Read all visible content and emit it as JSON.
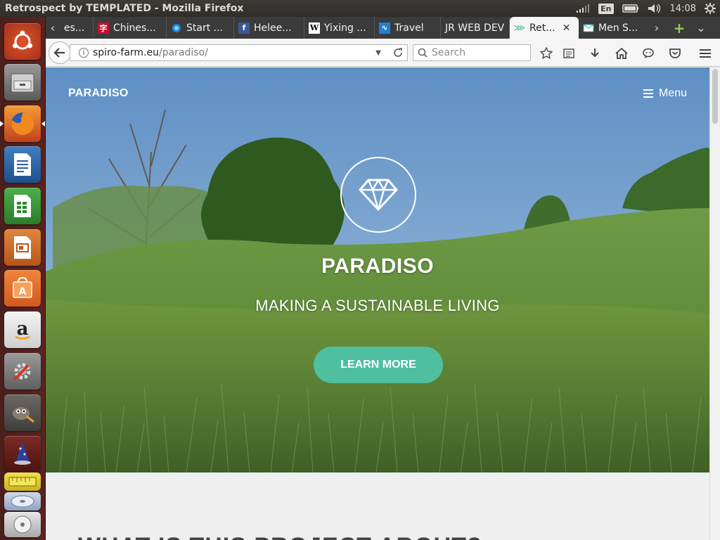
{
  "top_panel": {
    "window_title": "Retrospect by TEMPLATED - Mozilla Firefox",
    "lang": "En",
    "time": "14:08"
  },
  "launcher": {
    "items": [
      "ubuntu-dash",
      "files",
      "firefox",
      "libreoffice-writer",
      "libreoffice-calc",
      "libreoffice-impress",
      "ubuntu-software",
      "amazon",
      "system-settings",
      "gimp",
      "wizard",
      "ruler",
      "disc",
      "dvd"
    ]
  },
  "tabs": [
    {
      "label": "es...",
      "favicon": "tab-favicon"
    },
    {
      "label": "Chines...",
      "favicon": "chinese-icon"
    },
    {
      "label": "Start ...",
      "favicon": "start-icon"
    },
    {
      "label": "Helee...",
      "favicon": "facebook-icon"
    },
    {
      "label": "Yixing ...",
      "favicon": "wikipedia-icon"
    },
    {
      "label": "Travel",
      "favicon": "travel-icon"
    },
    {
      "label": "JR WEB DEV",
      "favicon": "none"
    },
    {
      "label": "Ret...",
      "favicon": "templated-icon",
      "active": true
    },
    {
      "label": "Men S...",
      "favicon": "mail-icon"
    }
  ],
  "navbar": {
    "url_host": "spiro-farm.eu",
    "url_path": "/paradiso/",
    "search_placeholder": "Search"
  },
  "page": {
    "logo": "PARADISO",
    "menu_label": "Menu",
    "hero_title": "PARADISO",
    "hero_subtitle": "MAKING A SUSTAINABLE LIVING",
    "cta_label": "LEARN MORE",
    "section_heading": "WHAT IS THIS PROJECT ABOUT?"
  },
  "colors": {
    "accent": "#4fbfa0",
    "launcher_bg": "#5a2420",
    "panel_bg": "#3c3b37"
  }
}
